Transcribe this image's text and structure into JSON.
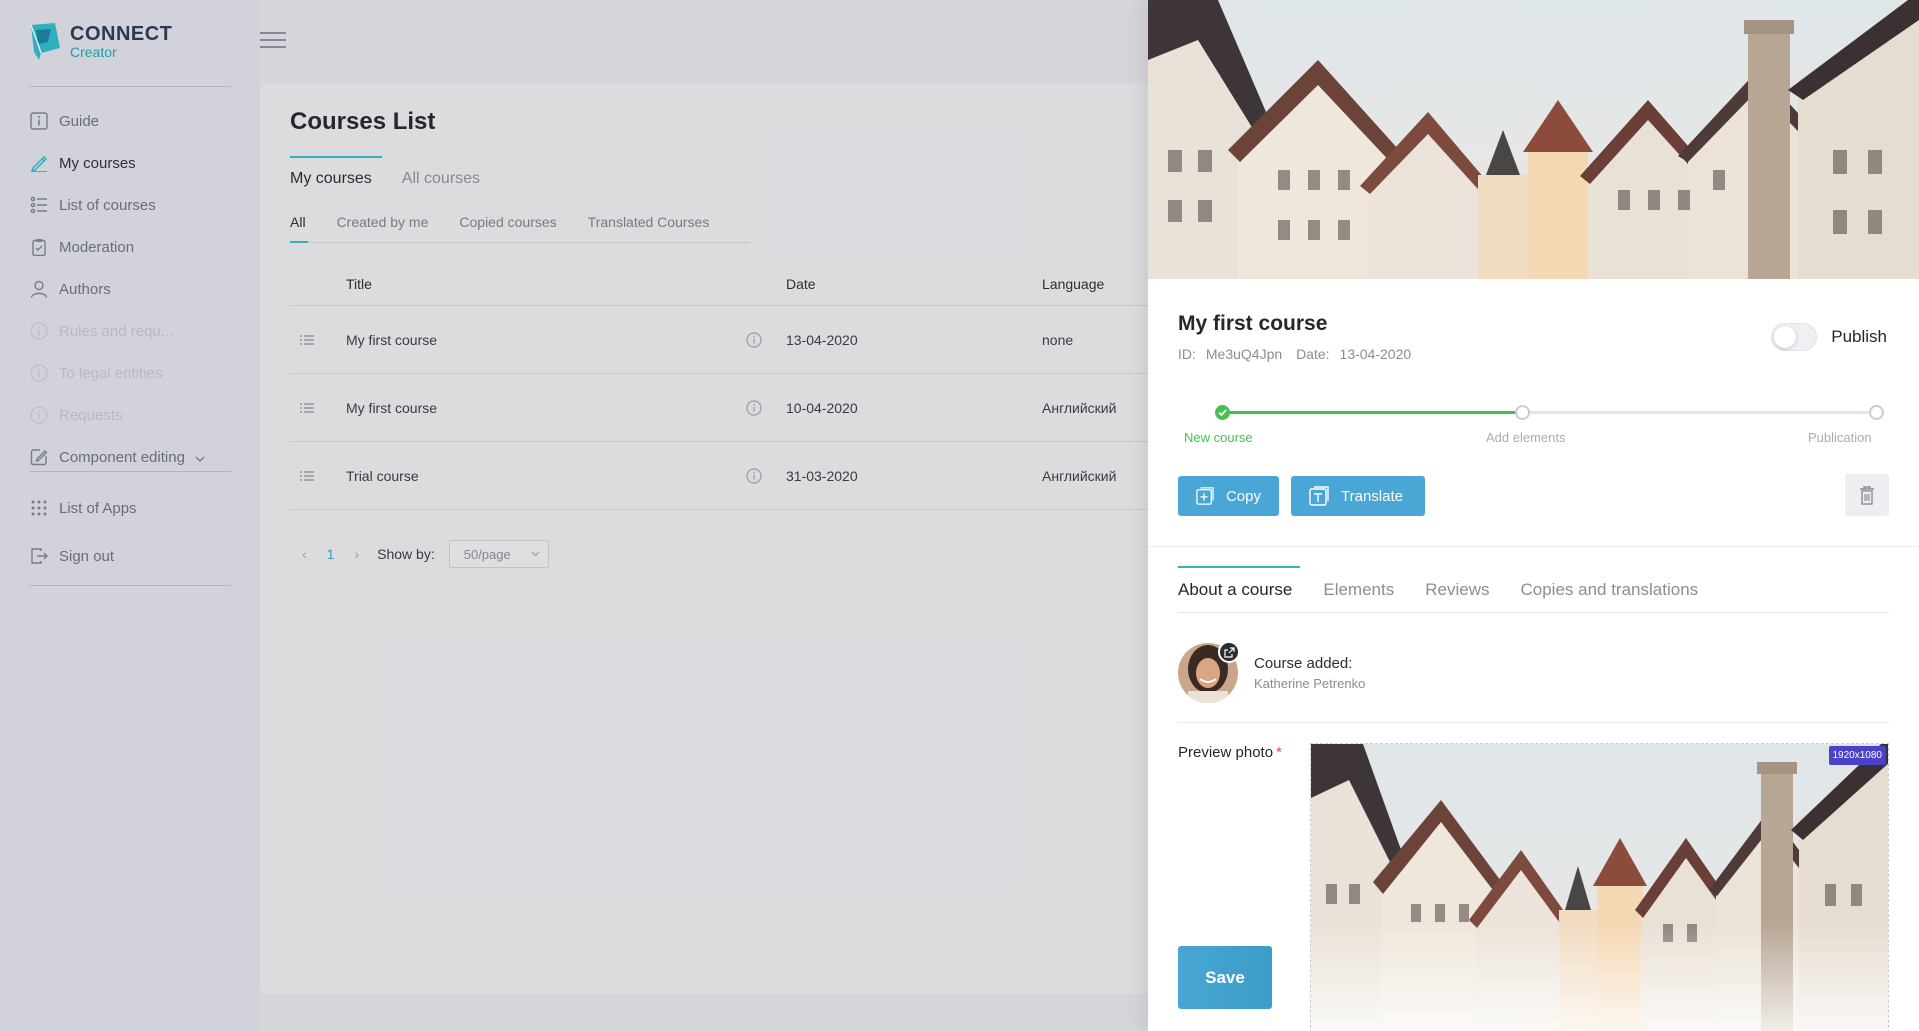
{
  "brand": {
    "title": "CONNECT",
    "subtitle": "Creator"
  },
  "sidebar": {
    "items": [
      {
        "label": "Guide",
        "icon": "info-square-icon",
        "state": "normal"
      },
      {
        "label": "My courses",
        "icon": "pencil-icon",
        "state": "active"
      },
      {
        "label": "List of courses",
        "icon": "list-icon",
        "state": "normal"
      },
      {
        "label": "Moderation",
        "icon": "clipboard-icon",
        "state": "normal"
      },
      {
        "label": "Authors",
        "icon": "user-icon",
        "state": "normal"
      },
      {
        "label": "Rules and requ...",
        "icon": "info-circle-icon",
        "state": "disabled"
      },
      {
        "label": "To legal entities",
        "icon": "info-circle-icon",
        "state": "disabled"
      },
      {
        "label": "Requests",
        "icon": "info-circle-icon",
        "state": "disabled"
      },
      {
        "label": "Component editing",
        "icon": "edit-icon",
        "state": "normal"
      }
    ],
    "bottom": [
      {
        "label": "List of Apps",
        "icon": "grid-icon"
      },
      {
        "label": "Sign out",
        "icon": "sign-out-icon"
      }
    ]
  },
  "main": {
    "title": "Courses List",
    "tabs": [
      "My courses",
      "All courses"
    ],
    "subtabs": [
      "All",
      "Created by me",
      "Copied courses",
      "Translated Courses"
    ],
    "columns": {
      "title": "Title",
      "date": "Date",
      "language": "Language"
    },
    "rows": [
      {
        "title": "My first course",
        "date": "13-04-2020",
        "language": "none"
      },
      {
        "title": "My first course",
        "date": "10-04-2020",
        "language": "Английский"
      },
      {
        "title": "Trial course",
        "date": "31-03-2020",
        "language": "Английский"
      }
    ],
    "pagination": {
      "page": "1",
      "show_by_label": "Show by:",
      "page_size": "50/page"
    }
  },
  "drawer": {
    "title": "My first course",
    "id_label": "ID:",
    "id_value": "Me3uQ4Jpn",
    "date_label": "Date:",
    "date_value": "13-04-2020",
    "publish_label": "Publish",
    "publish_on": false,
    "steps": [
      {
        "label": "New course",
        "done": true
      },
      {
        "label": "Add elements",
        "done": false
      },
      {
        "label": "Publication",
        "done": false
      }
    ],
    "buttons": {
      "copy": "Copy",
      "translate": "Translate"
    },
    "tabs": [
      "About a course",
      "Elements",
      "Reviews",
      "Copies and translations"
    ],
    "author_label": "Course added:",
    "author_name": "Katherine Petrenko",
    "preview_label": "Preview photo",
    "required_mark": "*",
    "resolution": "1920x1080",
    "save_label": "Save"
  },
  "colors": {
    "accent": "#38b4c0",
    "button": "#4aa6d4",
    "success": "#47c14e",
    "badge": "#4b42c9"
  }
}
